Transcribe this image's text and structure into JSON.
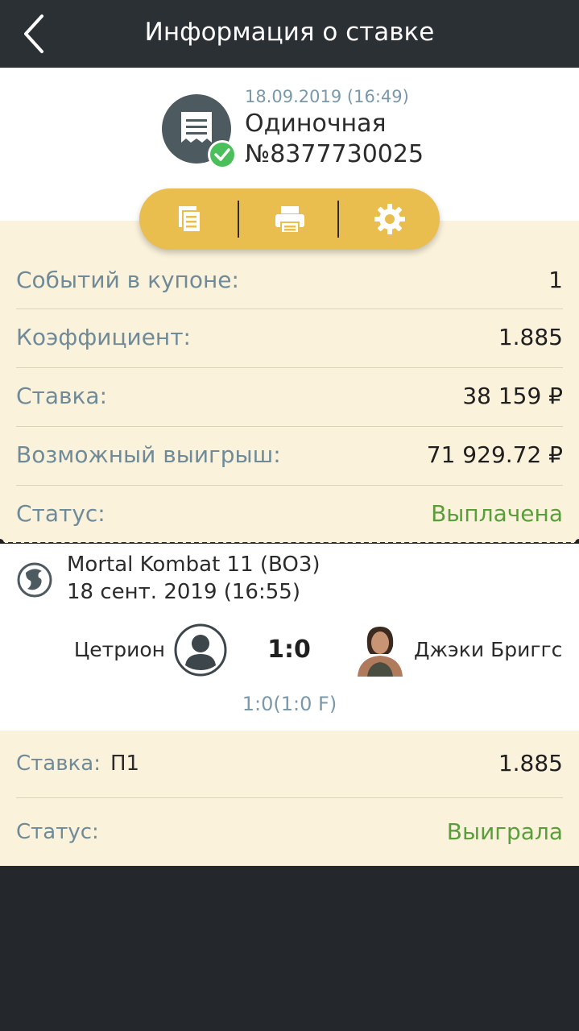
{
  "topbar": {
    "title": "Информация о ставке"
  },
  "bet": {
    "date": "18.09.2019 (16:49)",
    "type": "Одиночная",
    "number": "№8377730025"
  },
  "actions": [
    {
      "icon": "copy-icon"
    },
    {
      "icon": "print-icon"
    },
    {
      "icon": "settings-icon"
    }
  ],
  "summary": {
    "events_label": "Событий в купоне:",
    "events_value": "1",
    "coef_label": "Коэффициент:",
    "coef_value": "1.885",
    "stake_label": "Ставка:",
    "stake_value": "38 159 ₽",
    "win_label": "Возможный выигрыш:",
    "win_value": "71 929.72 ₽",
    "status_label": "Статус:",
    "status_value": "Выплачена"
  },
  "event": {
    "name": "Mortal Kombat 11 (BO3)",
    "date": "18 сент. 2019 (16:55)",
    "team1": "Цетрион",
    "team2": "Джэки Бриггс",
    "score": "1:0",
    "sub_score": "1:0(1:0 F)"
  },
  "pick": {
    "stake_label": "Ставка:",
    "pick": "П1",
    "coef": "1.885",
    "status_label": "Статус:",
    "status_value": "Выиграла"
  },
  "colors": {
    "accent": "#e9bd4e",
    "cream": "#fbf2db",
    "status_green": "#5a9e3c",
    "topbar": "#2b3035"
  }
}
